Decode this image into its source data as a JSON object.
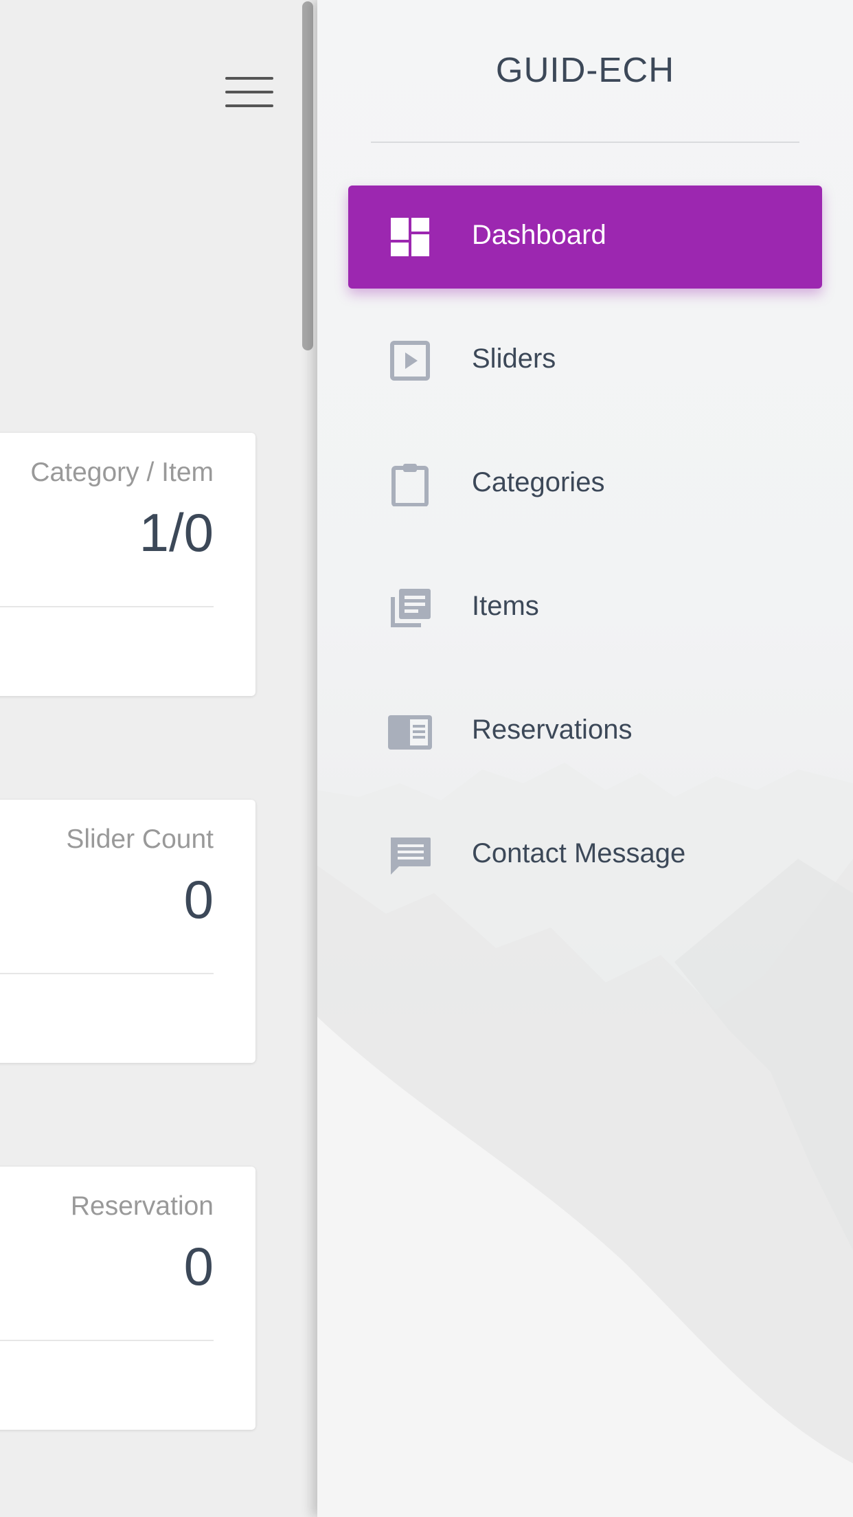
{
  "brand": {
    "title": "GUID-ECH"
  },
  "sidebar": {
    "items": [
      {
        "label": "Dashboard",
        "icon": "dashboard-icon",
        "active": true
      },
      {
        "label": "Sliders",
        "icon": "slideshow-icon",
        "active": false
      },
      {
        "label": "Categories",
        "icon": "clipboard-icon",
        "active": false
      },
      {
        "label": "Items",
        "icon": "library-books-icon",
        "active": false
      },
      {
        "label": "Reservations",
        "icon": "chrome-reader-icon",
        "active": false
      },
      {
        "label": "Contact Message",
        "icon": "message-icon",
        "active": false
      }
    ]
  },
  "cards": [
    {
      "category": "Category / Item",
      "value": "1/0"
    },
    {
      "category": "Slider Count",
      "value": "0"
    },
    {
      "category": "Reservation",
      "value": "0"
    }
  ],
  "colors": {
    "accent": "#9c27b0",
    "text": "#3c4858",
    "muted": "#999999",
    "icon": "#a9afbb"
  }
}
